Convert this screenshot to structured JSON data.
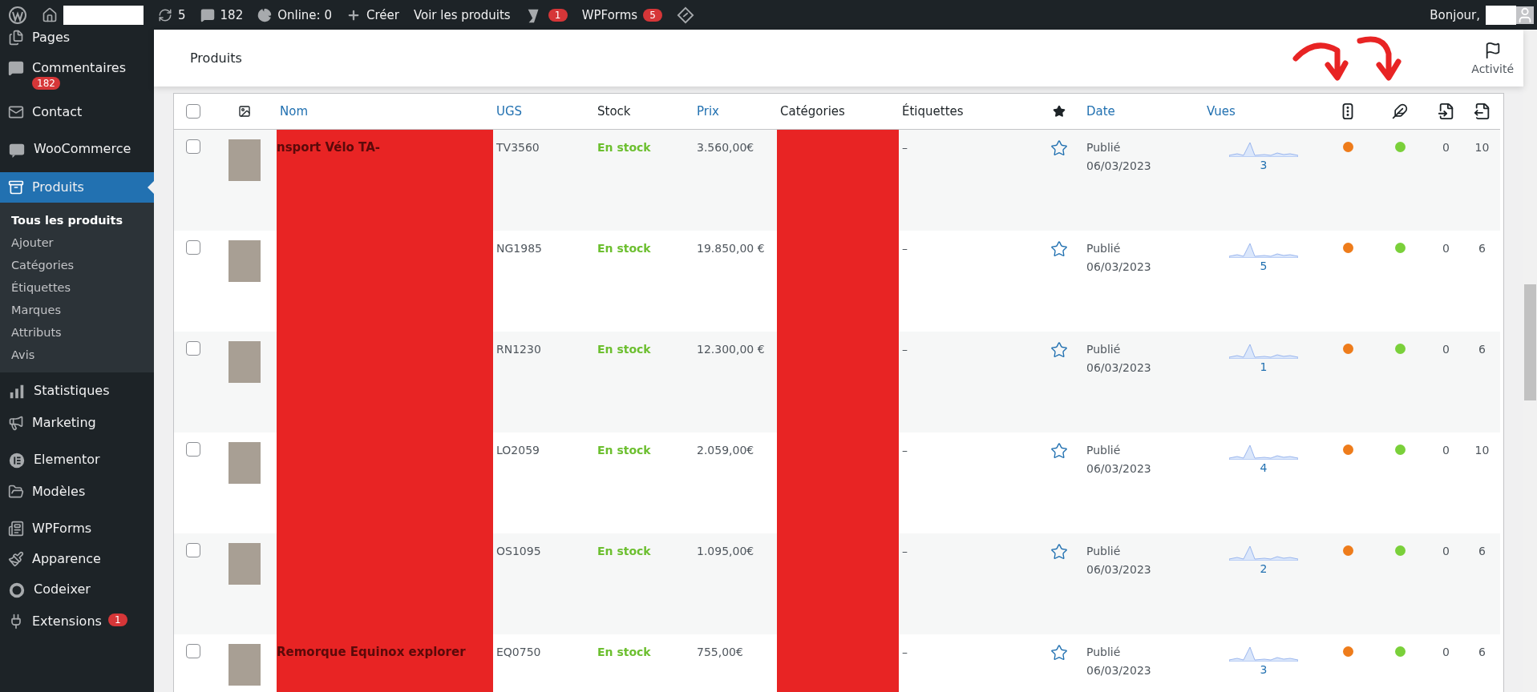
{
  "admin_bar": {
    "updates": "5",
    "comments": "182",
    "online": "Online: 0",
    "create": "Créer",
    "view_products": "Voir les produits",
    "seo_badge": "1",
    "wpforms": "WPForms",
    "wpforms_badge": "5",
    "greeting": "Bonjour,"
  },
  "sidebar": {
    "items": [
      {
        "label": "Pages",
        "selected": false
      },
      {
        "label": "Commentaires",
        "badge": "182",
        "selected": false
      },
      {
        "label": "Contact",
        "selected": false
      },
      {
        "label": "WooCommerce",
        "selected": false
      },
      {
        "label": "Produits",
        "selected": true,
        "children": [
          {
            "label": "Tous les produits",
            "selected": true
          },
          {
            "label": "Ajouter",
            "selected": false
          },
          {
            "label": "Catégories",
            "selected": false
          },
          {
            "label": "Étiquettes",
            "selected": false
          },
          {
            "label": "Marques",
            "selected": false
          },
          {
            "label": "Attributs",
            "selected": false
          },
          {
            "label": "Avis",
            "selected": false
          }
        ]
      },
      {
        "label": "Statistiques",
        "selected": false
      },
      {
        "label": "Marketing",
        "selected": false
      },
      {
        "label": "Elementor",
        "selected": false
      },
      {
        "label": "Modèles",
        "selected": false
      },
      {
        "label": "WPForms",
        "selected": false
      },
      {
        "label": "Apparence",
        "selected": false
      },
      {
        "label": "Codeixer",
        "selected": false
      },
      {
        "label": "Extensions",
        "badge": "1",
        "selected": false
      }
    ]
  },
  "page_header": {
    "title": "Produits",
    "activity": "Activité"
  },
  "table": {
    "select_all": {
      "checked": false
    },
    "columns": {
      "name": "Nom",
      "sku": "UGS",
      "stock": "Stock",
      "price": "Prix",
      "categories": "Catégories",
      "tags": "Étiquettes",
      "date": "Date",
      "views": "Vues"
    },
    "rows": [
      {
        "checked": false,
        "name": "nsport Vélo TA-",
        "sku": "TV3560",
        "stock": "En stock",
        "price": "3.560,00€",
        "tags": "–",
        "featured": false,
        "status": "Publié",
        "date": "06/03/2023",
        "views": "3",
        "seo": {
          "color": "#ee7c1b"
        },
        "readability": {
          "color": "#7ad03a"
        },
        "links_in": "0",
        "links_out": "10"
      },
      {
        "checked": false,
        "sku": "NG1985",
        "stock": "En stock",
        "price": "19.850,00 €",
        "tags": "–",
        "featured": false,
        "status": "Publié",
        "date": "06/03/2023",
        "views": "5",
        "seo": {
          "color": "#ee7c1b"
        },
        "readability": {
          "color": "#7ad03a"
        },
        "links_in": "0",
        "links_out": "6"
      },
      {
        "checked": false,
        "sku": "RN1230",
        "stock": "En stock",
        "price": "12.300,00 €",
        "tags": "–",
        "featured": false,
        "status": "Publié",
        "date": "06/03/2023",
        "views": "1",
        "seo": {
          "color": "#ee7c1b"
        },
        "readability": {
          "color": "#7ad03a"
        },
        "links_in": "0",
        "links_out": "6"
      },
      {
        "checked": false,
        "sku": "LO2059",
        "stock": "En stock",
        "price": "2.059,00€",
        "tags": "–",
        "featured": false,
        "status": "Publié",
        "date": "06/03/2023",
        "views": "4",
        "seo": {
          "color": "#ee7c1b"
        },
        "readability": {
          "color": "#7ad03a"
        },
        "links_in": "0",
        "links_out": "10"
      },
      {
        "checked": false,
        "sku": "OS1095",
        "stock": "En stock",
        "price": "1.095,00€",
        "tags": "–",
        "featured": false,
        "status": "Publié",
        "date": "06/03/2023",
        "views": "2",
        "seo": {
          "color": "#ee7c1b"
        },
        "readability": {
          "color": "#7ad03a"
        },
        "links_in": "0",
        "links_out": "6"
      },
      {
        "checked": false,
        "name": "Remorque Equinox explorer",
        "sku": "EQ0750",
        "stock": "En stock",
        "price": "755,00€",
        "tags": "–",
        "featured": false,
        "status": "Publié",
        "date": "06/03/2023",
        "views": "3",
        "seo": {
          "color": "#ee7c1b"
        },
        "readability": {
          "color": "#7ad03a"
        },
        "links_in": "0",
        "links_out": "6"
      }
    ]
  }
}
